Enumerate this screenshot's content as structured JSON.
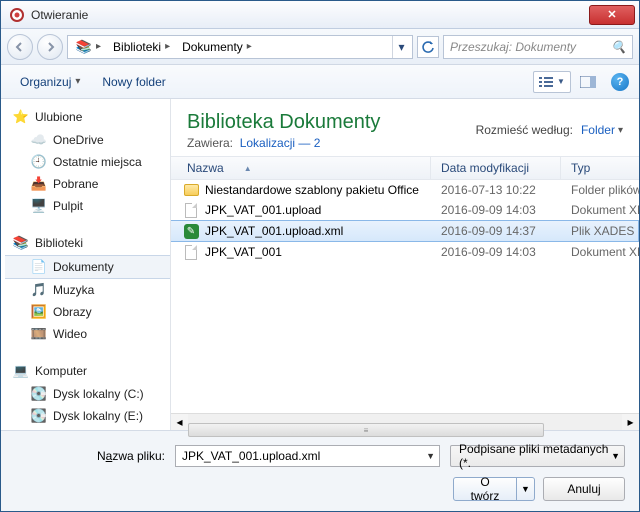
{
  "window": {
    "title": "Otwieranie"
  },
  "breadcrumb": {
    "seg1": "Biblioteki",
    "seg2": "Dokumenty"
  },
  "search": {
    "placeholder": "Przeszukaj: Dokumenty"
  },
  "toolbar": {
    "organize": "Organizuj",
    "newfolder": "Nowy folder"
  },
  "nav": {
    "fav_title": "Ulubione",
    "fav": [
      "OneDrive",
      "Ostatnie miejsca",
      "Pobrane",
      "Pulpit"
    ],
    "lib_title": "Biblioteki",
    "lib": [
      "Dokumenty",
      "Muzyka",
      "Obrazy",
      "Wideo"
    ],
    "comp_title": "Komputer",
    "comp": [
      "Dysk lokalny (C:)",
      "Dysk lokalny (E:)"
    ]
  },
  "library": {
    "title": "Biblioteka Dokumenty",
    "contains_label": "Zawiera:",
    "contains_link": "Lokalizacji — 2",
    "arrange_label": "Rozmieść według:",
    "arrange_value": "Folder"
  },
  "columns": {
    "name": "Nazwa",
    "date": "Data modyfikacji",
    "type": "Typ"
  },
  "files": [
    {
      "name": "Niestandardowe szablony pakietu Office",
      "date": "2016-07-13 10:22",
      "type": "Folder plików",
      "icon": "folder"
    },
    {
      "name": "JPK_VAT_001.upload",
      "date": "2016-09-09 14:03",
      "type": "Dokument XML",
      "icon": "doc"
    },
    {
      "name": "JPK_VAT_001.upload.xml",
      "date": "2016-09-09 14:37",
      "type": "Plik XADES",
      "icon": "xml",
      "selected": true
    },
    {
      "name": "JPK_VAT_001",
      "date": "2016-09-09 14:03",
      "type": "Dokument XML",
      "icon": "doc"
    }
  ],
  "footer": {
    "filename_label_pre": "N",
    "filename_label_und": "a",
    "filename_label_post": "zwa pliku:",
    "filename_value": "JPK_VAT_001.upload.xml",
    "filter": "Podpisane pliki metadanych (*.",
    "open": "Otwórz",
    "open_und": "O",
    "open_rest": "twórz",
    "cancel": "Anuluj"
  }
}
